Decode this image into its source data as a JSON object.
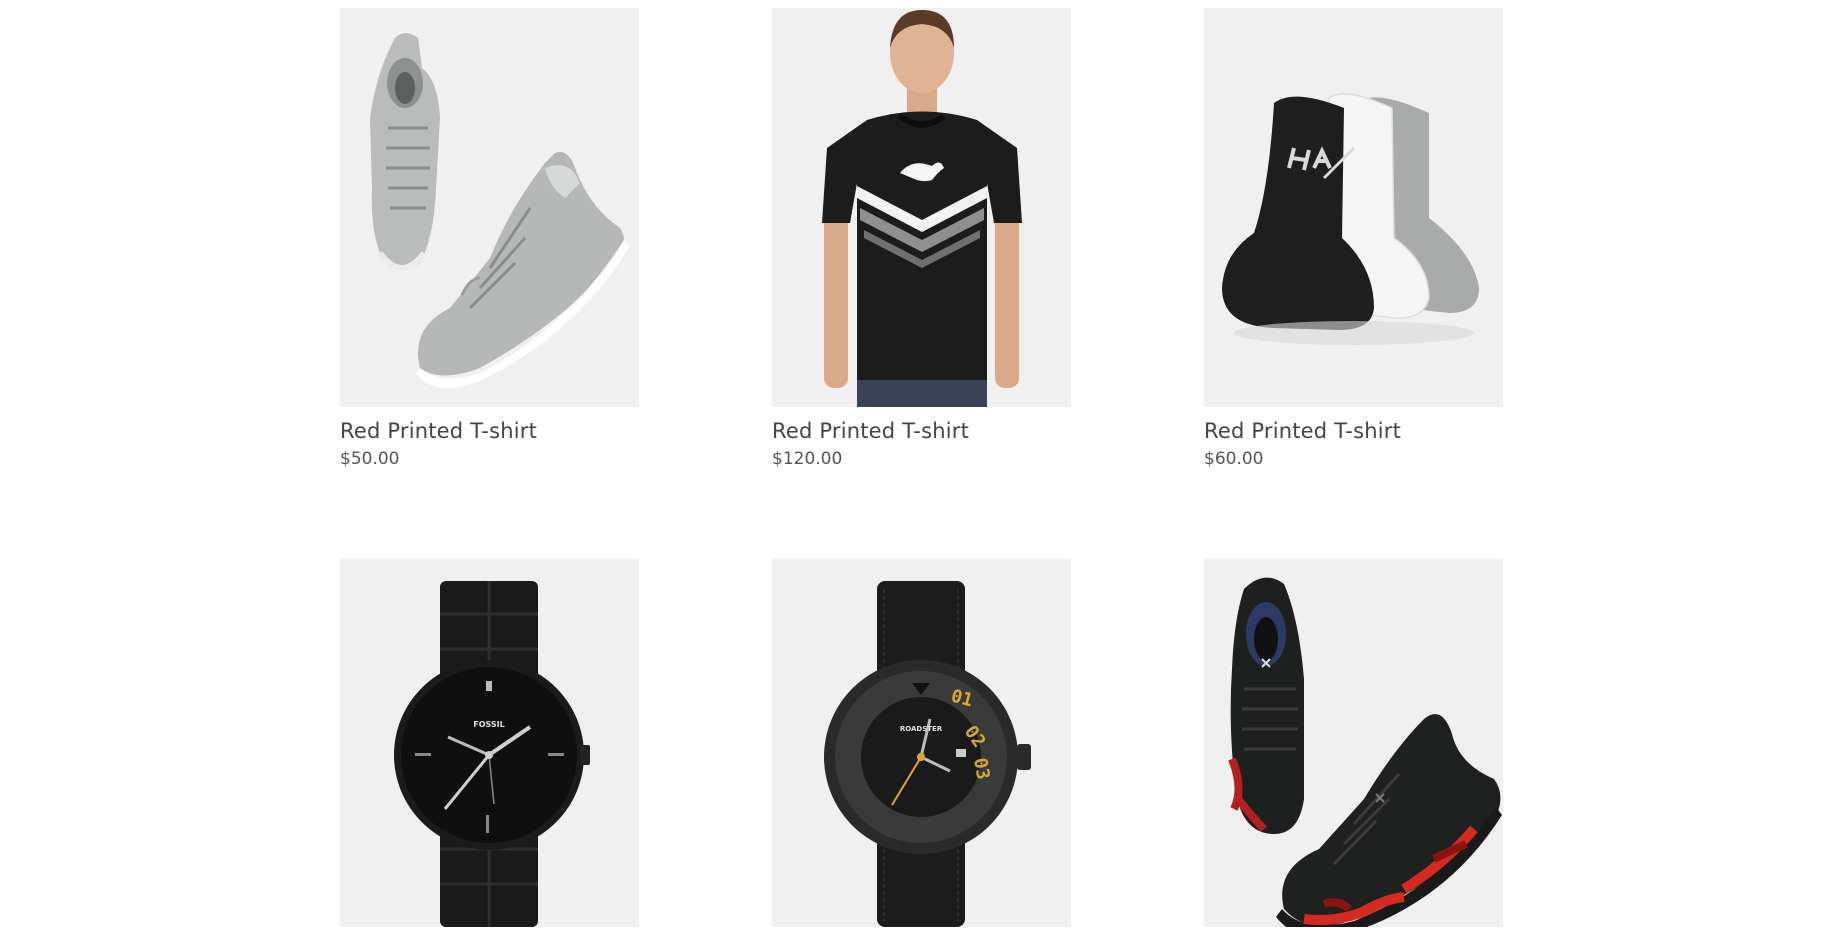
{
  "products": [
    {
      "title": "Red Printed T-shirt",
      "price": "$50.00",
      "image": "grey-high-top-sneakers"
    },
    {
      "title": "Red Printed T-shirt",
      "price": "$120.00",
      "image": "black-puma-tshirt-model"
    },
    {
      "title": "Red Printed T-shirt",
      "price": "$60.00",
      "image": "hrx-socks-three-pack"
    },
    {
      "title": "",
      "price": "",
      "image": "fossil-black-watch",
      "watch_brand": "FOSSIL"
    },
    {
      "title": "",
      "price": "",
      "image": "roadster-black-watch",
      "watch_brand": "ROADSTER",
      "watch_digits": [
        "01",
        "02",
        "03"
      ]
    },
    {
      "title": "",
      "price": "",
      "image": "black-red-camo-running-shoes"
    }
  ],
  "colors": {
    "card_background": "#f0f0f0",
    "title_text": "#444444",
    "price_text": "#555555"
  }
}
